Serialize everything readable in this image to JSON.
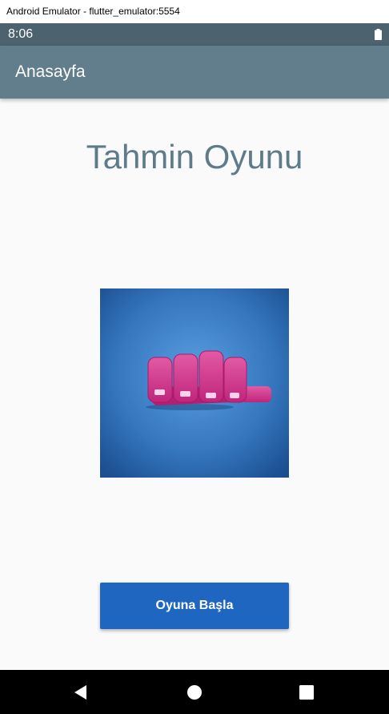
{
  "window": {
    "title": "Android Emulator - flutter_emulator:5554"
  },
  "status_bar": {
    "time": "8:06",
    "battery_icon": "battery-full-icon"
  },
  "app_bar": {
    "title": "Anasayfa"
  },
  "main": {
    "heading": "Tahmin Oyunu",
    "image": {
      "icon": "hand-fingers-illustration"
    },
    "start_button_label": "Oyuna Başla"
  },
  "nav_bar": {
    "back_icon": "back-triangle-icon",
    "home_icon": "home-circle-icon",
    "recents_icon": "recents-square-icon"
  },
  "colors": {
    "status_bar": "#4c636f",
    "app_bar": "#627d8b",
    "heading": "#5f7b89",
    "button": "#1e66c0",
    "image_bg": "#3a80c6",
    "hand": "#d6338f"
  }
}
